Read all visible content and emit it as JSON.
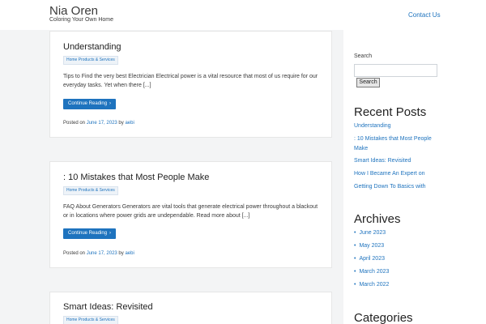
{
  "header": {
    "site_title": "Nia Oren",
    "tagline": "Coloring Your Own Home",
    "nav": [
      "Contact Us"
    ]
  },
  "articles": [
    {
      "title": "Understanding",
      "category": "Home Products & Services",
      "excerpt": "Tips to Find the very best Electrician Electrical power is a vital resource that most of us require for our everyday tasks. Yet when there [...]",
      "read_more": "Continue Reading",
      "posted_on": "Posted on",
      "date": "June 17, 2023",
      "by": "by",
      "author": "aebi"
    },
    {
      "title": ": 10 Mistakes that Most People Make",
      "category": "Home Products & Services",
      "excerpt": "FAQ About Generators Generators are vital tools that generate electrical power throughout a blackout or in locations where power grids are undependable. Read more about [...]",
      "read_more": "Continue Reading",
      "posted_on": "Posted on",
      "date": "June 17, 2023",
      "by": "by",
      "author": "aebi"
    },
    {
      "title": "Smart Ideas: Revisited",
      "category": "Home Products & Services"
    }
  ],
  "sidebar": {
    "search_label": "Search",
    "search_button": "Search",
    "recent_title": "Recent Posts",
    "recent_posts": [
      "Understanding",
      ": 10 Mistakes that Most People Make",
      "Smart Ideas: Revisited",
      "How I Became An Expert on",
      "Getting Down To Basics with"
    ],
    "archives_title": "Archives",
    "archives": [
      "June 2023",
      "May 2023",
      "April 2023",
      "March 2023",
      "March 2022"
    ],
    "categories_title": "Categories"
  },
  "colors": {
    "accent": "#1e73be",
    "page_bg": "#f3f4f5",
    "card_bg": "#ffffff"
  },
  "icons": {
    "read_more": "chevron-right-icon",
    "archive_bullet": "bullet-icon"
  }
}
